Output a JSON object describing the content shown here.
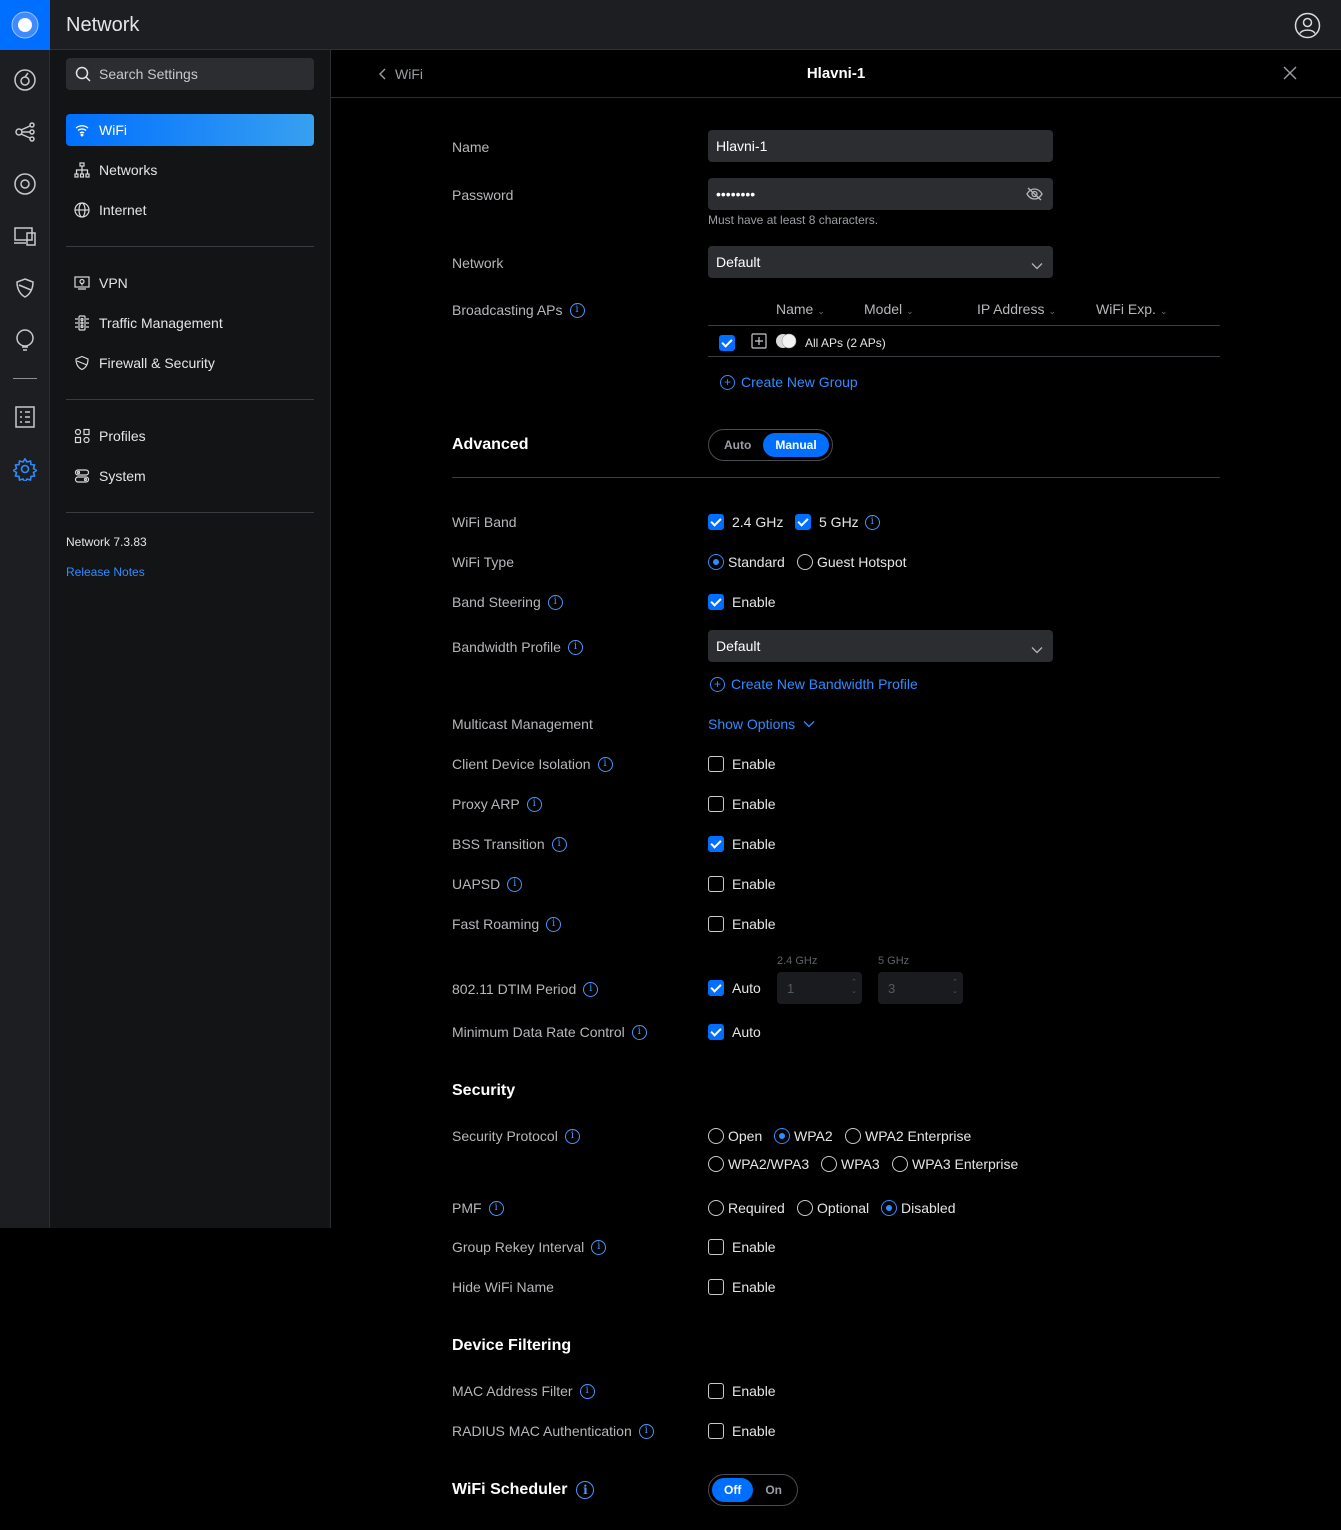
{
  "app": {
    "title": "Network"
  },
  "search": {
    "placeholder": "Search Settings"
  },
  "sidebar": {
    "items": [
      {
        "label": "WiFi"
      },
      {
        "label": "Networks"
      },
      {
        "label": "Internet"
      },
      {
        "label": "VPN"
      },
      {
        "label": "Traffic Management"
      },
      {
        "label": "Firewall & Security"
      },
      {
        "label": "Profiles"
      },
      {
        "label": "System"
      }
    ],
    "version": "Network 7.3.83",
    "release_notes": "Release Notes"
  },
  "header": {
    "back_label": "WiFi",
    "title": "Hlavni-1"
  },
  "form": {
    "name": {
      "label": "Name",
      "value": "Hlavni-1"
    },
    "password": {
      "label": "Password",
      "value": "••••••••",
      "hint": "Must have at least 8 characters."
    },
    "network": {
      "label": "Network",
      "value": "Default"
    },
    "broadcasting": {
      "label": "Broadcasting APs",
      "columns": [
        "Name",
        "Model",
        "IP Address",
        "WiFi Exp."
      ],
      "row_label": "All APs (2 APs)",
      "create_group": "Create New Group"
    }
  },
  "advanced": {
    "title": "Advanced",
    "mode_options": [
      "Auto",
      "Manual"
    ],
    "mode_selected": "Manual",
    "wifi_band": {
      "label": "WiFi Band",
      "opt1": "2.4 GHz",
      "opt2": "5 GHz"
    },
    "wifi_type": {
      "label": "WiFi Type",
      "opt1": "Standard",
      "opt2": "Guest Hotspot"
    },
    "band_steering": {
      "label": "Band Steering",
      "opt": "Enable"
    },
    "bandwidth_profile": {
      "label": "Bandwidth Profile",
      "value": "Default",
      "create": "Create New Bandwidth Profile"
    },
    "multicast": {
      "label": "Multicast Management",
      "link": "Show Options"
    },
    "client_isolation": {
      "label": "Client Device Isolation",
      "opt": "Enable"
    },
    "proxy_arp": {
      "label": "Proxy ARP",
      "opt": "Enable"
    },
    "bss_transition": {
      "label": "BSS Transition",
      "opt": "Enable"
    },
    "uapsd": {
      "label": "UAPSD",
      "opt": "Enable"
    },
    "fast_roaming": {
      "label": "Fast Roaming",
      "opt": "Enable"
    },
    "dtim": {
      "label": "802.11 DTIM Period",
      "opt": "Auto",
      "band1": "2.4 GHz",
      "band2": "5 GHz",
      "val1": "1",
      "val2": "3"
    },
    "min_rate": {
      "label": "Minimum Data Rate Control",
      "opt": "Auto"
    }
  },
  "security": {
    "title": "Security",
    "protocol": {
      "label": "Security Protocol",
      "options": [
        "Open",
        "WPA2",
        "WPA2 Enterprise",
        "WPA2/WPA3",
        "WPA3",
        "WPA3 Enterprise"
      ],
      "selected": "WPA2"
    },
    "pmf": {
      "label": "PMF",
      "options": [
        "Required",
        "Optional",
        "Disabled"
      ],
      "selected": "Disabled"
    },
    "group_rekey": {
      "label": "Group Rekey Interval",
      "opt": "Enable"
    },
    "hide_name": {
      "label": "Hide WiFi Name",
      "opt": "Enable"
    }
  },
  "device_filtering": {
    "title": "Device Filtering",
    "mac_filter": {
      "label": "MAC Address Filter",
      "opt": "Enable"
    },
    "radius_mac": {
      "label": "RADIUS MAC Authentication",
      "opt": "Enable"
    }
  },
  "scheduler": {
    "title": "WiFi Scheduler",
    "options": [
      "Off",
      "On"
    ],
    "selected": "Off"
  },
  "colors": {
    "accent": "#006fff",
    "link": "#2f8cff",
    "background": "#000000",
    "sidebar": "#131416"
  }
}
